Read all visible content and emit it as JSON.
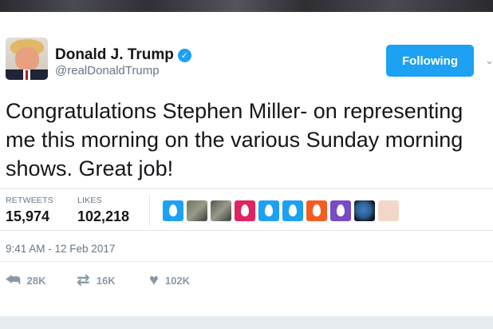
{
  "tweet": {
    "author": {
      "name": "Donald J. Trump",
      "handle": "@realDonaldTrump",
      "verified_icon": "verified-badge-icon"
    },
    "follow_button": "Following",
    "text": "Congratulations Stephen Miller- on representing me this morning on the various Sunday morning shows. Great job!",
    "stats": {
      "retweets_label": "RETWEETS",
      "retweets_value": "15,974",
      "likes_label": "LIKES",
      "likes_value": "102,218"
    },
    "likers": [
      {
        "icon": "default-egg-avatar",
        "color": "#1da1f2"
      },
      {
        "icon": "photo-avatar",
        "color": "#6a7a5a"
      },
      {
        "icon": "photo-avatar",
        "color": "#555555"
      },
      {
        "icon": "default-egg-avatar",
        "color": "#e0245e"
      },
      {
        "icon": "default-egg-avatar",
        "color": "#1da1f2"
      },
      {
        "icon": "default-egg-avatar",
        "color": "#1da1f2"
      },
      {
        "icon": "default-egg-avatar",
        "color": "#f45d22"
      },
      {
        "icon": "default-egg-avatar",
        "color": "#794bc4"
      },
      {
        "icon": "earth-photo-avatar",
        "color": "#1b2a44"
      },
      {
        "icon": "eye-photo-avatar",
        "color": "#f2d7c8"
      }
    ],
    "timestamp": "9:41 AM - 12 Feb 2017",
    "actions": {
      "reply_count": "28K",
      "retweet_count": "16K",
      "like_count": "102K"
    }
  },
  "colors": {
    "accent": "#1da1f2",
    "text": "#14171a",
    "muted": "#657786",
    "divider": "#e1e8ed"
  }
}
